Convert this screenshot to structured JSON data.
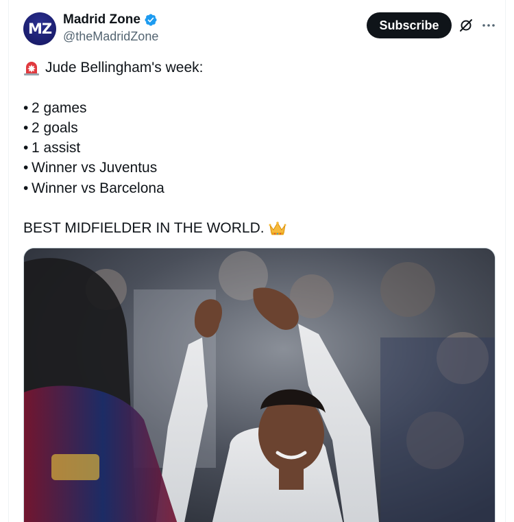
{
  "author": {
    "display_name": "Madrid Zone",
    "handle": "@theMadridZone",
    "avatar_text": "MZ",
    "verified": true,
    "verified_color": "#1d9bf0"
  },
  "actions": {
    "subscribe_label": "Subscribe",
    "grok_icon": "grok-icon",
    "more_icon": "more-icon"
  },
  "tweet": {
    "intro_emoji": "rotating-light-emoji",
    "intro": "Jude Bellingham's week:",
    "bullets": [
      "2 games",
      "2 goals",
      "1 assist",
      "Winner vs Juventus",
      "Winner vs Barcelona"
    ],
    "closing": "BEST MIDFIELDER IN THE WORLD.",
    "closing_emoji": "crown-emoji"
  },
  "media": {
    "type": "photo"
  },
  "colors": {
    "text": "#0f1419",
    "secondary": "#536471",
    "button": "#0f1419",
    "border": "#cfd9de"
  }
}
